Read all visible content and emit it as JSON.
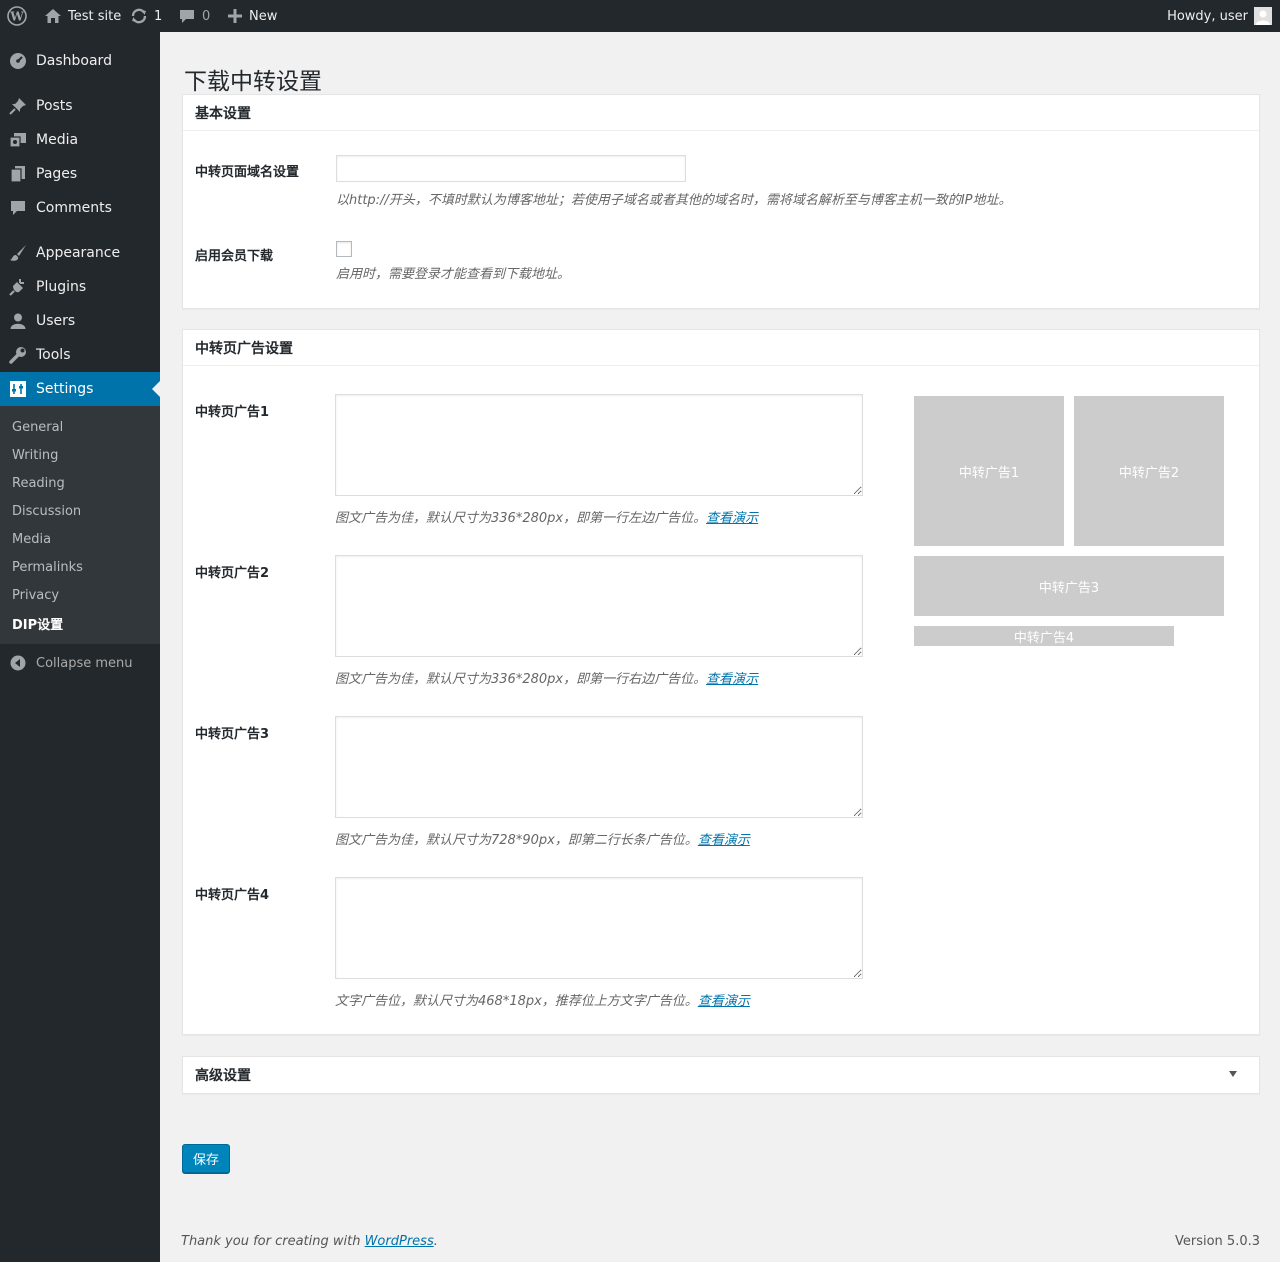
{
  "adminbar": {
    "site_name": "Test site",
    "updates_count": "1",
    "comments_count": "0",
    "new_label": "New",
    "howdy": "Howdy, user"
  },
  "sidebar": {
    "items": [
      {
        "label": "Dashboard",
        "icon": "dashboard-icon"
      },
      {
        "label": "Posts",
        "icon": "pin-icon"
      },
      {
        "label": "Media",
        "icon": "media-icon"
      },
      {
        "label": "Pages",
        "icon": "pages-icon"
      },
      {
        "label": "Comments",
        "icon": "comment-icon"
      },
      {
        "label": "Appearance",
        "icon": "brush-icon"
      },
      {
        "label": "Plugins",
        "icon": "plug-icon"
      },
      {
        "label": "Users",
        "icon": "user-icon"
      },
      {
        "label": "Tools",
        "icon": "wrench-icon"
      },
      {
        "label": "Settings",
        "icon": "settings-icon"
      }
    ],
    "submenu": [
      "General",
      "Writing",
      "Reading",
      "Discussion",
      "Media",
      "Permalinks",
      "Privacy",
      "DIP设置"
    ],
    "collapse_label": "Collapse menu"
  },
  "page": {
    "title": "下载中转设置"
  },
  "basic": {
    "heading": "基本设置",
    "domain_label": "中转页面域名设置",
    "domain_value": "",
    "domain_desc": "以http://开头，不填时默认为博客地址；若使用子域名或者其他的域名时，需将域名解析至与博客主机一致的IP地址。",
    "member_label": "启用会员下载",
    "member_checked": false,
    "member_desc": "启用时，需要登录才能查看到下载地址。"
  },
  "ads": {
    "heading": "中转页广告设置",
    "demo_link": "查看演示",
    "items": [
      {
        "label": "中转页广告1",
        "desc": "图文广告为佳，默认尺寸为336*280px，即第一行左边广告位。"
      },
      {
        "label": "中转页广告2",
        "desc": "图文广告为佳，默认尺寸为336*280px，即第一行右边广告位。"
      },
      {
        "label": "中转页广告3",
        "desc": "图文广告为佳，默认尺寸为728*90px，即第二行长条广告位。"
      },
      {
        "label": "中转页广告4",
        "desc": "文字广告位，默认尺寸为468*18px，推荐位上方文字广告位。"
      }
    ],
    "preview": [
      "中转广告1",
      "中转广告2",
      "中转广告3",
      "中转广告4"
    ]
  },
  "advanced": {
    "heading": "高级设置"
  },
  "save_label": "保存",
  "footer": {
    "thanks_prefix": "Thank you for creating with ",
    "wp_link": "WordPress",
    "thanks_suffix": ".",
    "version": "Version 5.0.3"
  },
  "colors": {
    "accent": "#0073aa",
    "adminbar": "#23282d",
    "submenu_bg": "#32373c",
    "ad_placeholder": "#cccccc"
  }
}
